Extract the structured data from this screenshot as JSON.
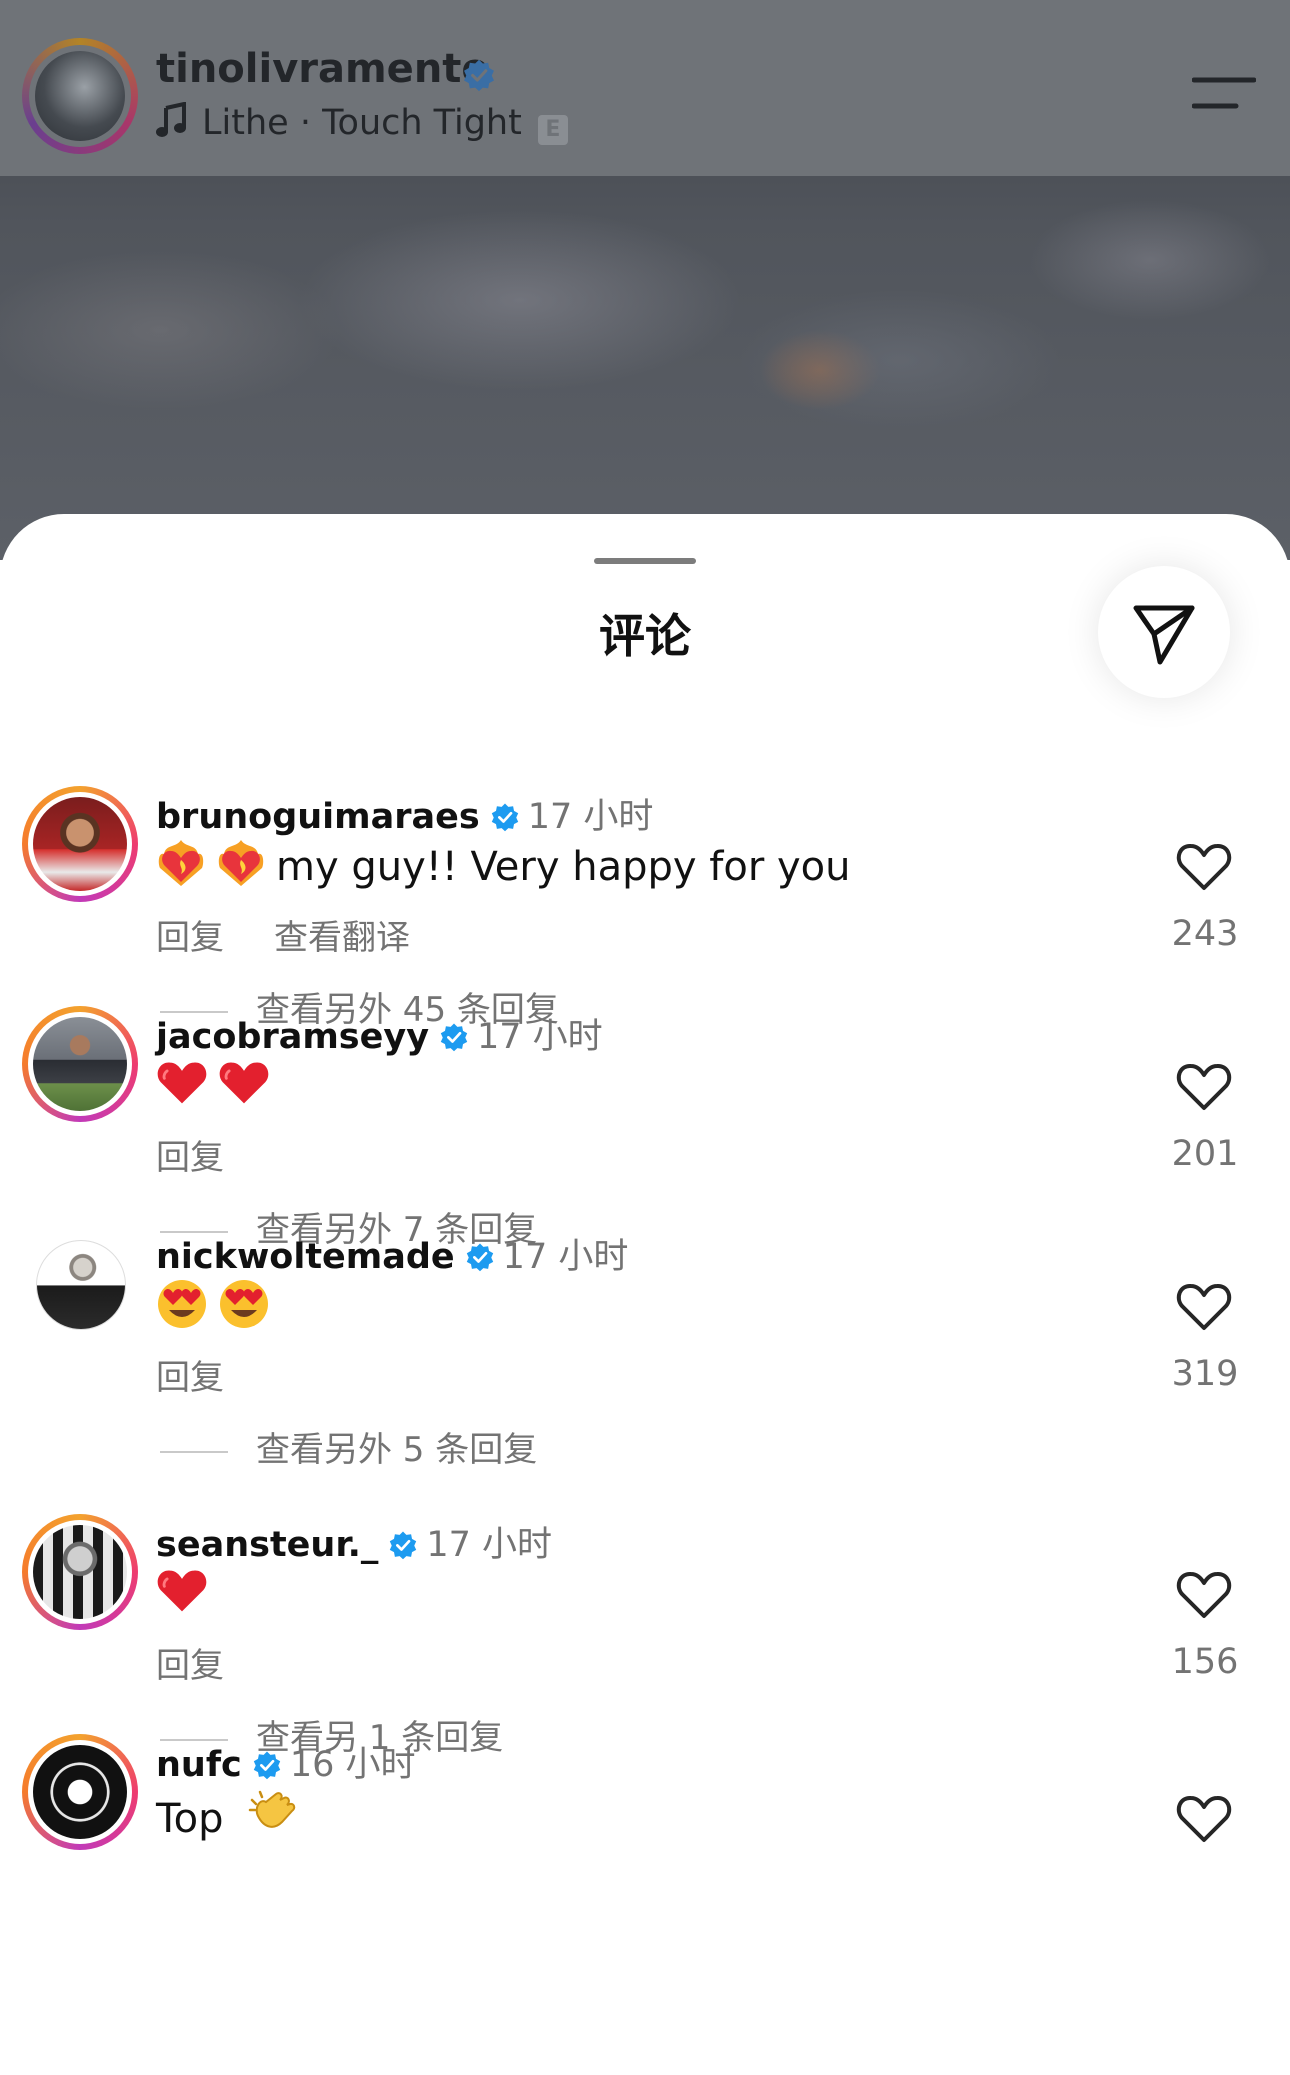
{
  "post": {
    "username": "tinolivramento",
    "song_title": "Lithe",
    "separator": "·",
    "artist": "Touch Tight",
    "explicit_badge": "E",
    "icons": [
      "music-note-icon",
      "verified-icon",
      "menu-icon"
    ]
  },
  "sheet": {
    "title": "评论",
    "share_icon": "send-icon"
  },
  "comments": [
    {
      "username": "brunoguimaraes",
      "time": "17 小时",
      "text": "my guy!! Very happy for you",
      "emojis": [
        "heart-on-fire",
        "heart-on-fire"
      ],
      "reply_label": "回复",
      "translate_label": "查看翻译",
      "view_replies": "查看另外 45 条回复",
      "likes": "243"
    },
    {
      "username": "jacobramseyy",
      "time": "17 小时",
      "text": "",
      "emojis": [
        "red-heart",
        "red-heart"
      ],
      "reply_label": "回复",
      "view_replies": "查看另外 7 条回复",
      "likes": "201"
    },
    {
      "username": "nickwoltemade",
      "time": "17 小时",
      "text": "",
      "emojis": [
        "heart-eyes",
        "heart-eyes"
      ],
      "reply_label": "回复",
      "view_replies": "查看另外 5 条回复",
      "likes": "319"
    },
    {
      "username": "seansteur._",
      "time": "17 小时",
      "text": "",
      "emojis": [
        "red-heart"
      ],
      "reply_label": "回复",
      "view_replies": "查看另 1 条回复",
      "likes": "156"
    },
    {
      "username": "nufc",
      "time": "16 小时",
      "text": "Top",
      "emojis": [
        "clapping-hands"
      ]
    }
  ],
  "colors": {
    "verified": "#1d9bf0",
    "secondary_text": "#737373",
    "story_ring": "#ee3b6f"
  }
}
